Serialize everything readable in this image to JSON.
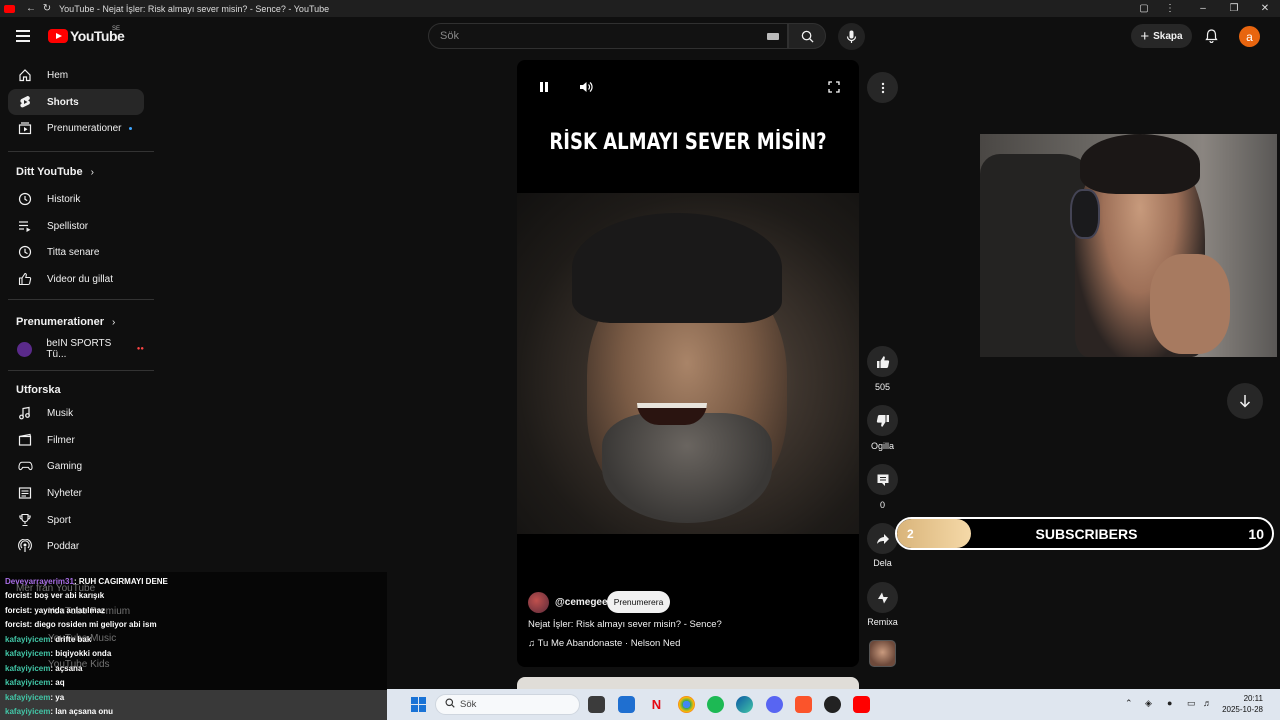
{
  "window": {
    "title": "YouTube - Nejat İşler: Risk almayı sever misin? - Sence? - YouTube"
  },
  "masthead": {
    "logo_text": "YouTube",
    "region": "SE",
    "search_placeholder": "Sök",
    "create_label": "Skapa",
    "avatar_letter": "a"
  },
  "sidebar": {
    "main": [
      {
        "label": "Hem",
        "icon": "home-icon"
      },
      {
        "label": "Shorts",
        "icon": "shorts-icon",
        "active": true
      },
      {
        "label": "Prenumerationer",
        "icon": "subscriptions-icon"
      }
    ],
    "you_title": "Ditt YouTube",
    "you": [
      {
        "label": "Historik",
        "icon": "history-icon"
      },
      {
        "label": "Spellistor",
        "icon": "playlist-icon"
      },
      {
        "label": "Titta senare",
        "icon": "watch-later-icon"
      },
      {
        "label": "Videor du gillat",
        "icon": "like-icon"
      }
    ],
    "subs_title": "Prenumerationer",
    "subs": [
      {
        "label": "beIN SPORTS Tü...",
        "icon": "channel-avatar"
      }
    ],
    "explore_title": "Utforska",
    "explore": [
      {
        "label": "Musik",
        "icon": "music-icon"
      },
      {
        "label": "Filmer",
        "icon": "film-icon"
      },
      {
        "label": "Gaming",
        "icon": "gaming-icon"
      },
      {
        "label": "Nyheter",
        "icon": "news-icon"
      },
      {
        "label": "Sport",
        "icon": "trophy-icon"
      },
      {
        "label": "Poddar",
        "icon": "podcast-icon"
      }
    ],
    "more_title": "Mer från YouTube",
    "more": [
      "YouTube Premium",
      "YouTube Music",
      "YouTube Kids"
    ]
  },
  "chat": [
    {
      "user": "Deveyarrayerim31",
      "msg": ": RUH CAGIRMAYI DENE",
      "color": "purple"
    },
    {
      "user": "forcist",
      "msg": ": boş ver abi karışık",
      "color": "white"
    },
    {
      "user": "forcist",
      "msg": ": yayında anlatılmaz",
      "color": "white"
    },
    {
      "user": "forcist",
      "msg": ": diego rosiden mi geliyor abi ism",
      "color": "white"
    },
    {
      "user": "kafayiyicem",
      "msg": ": drifte bak",
      "color": "green"
    },
    {
      "user": "kafayiyicem",
      "msg": ": biqiyokki onda",
      "color": "green"
    },
    {
      "user": "kafayiyicem",
      "msg": ": açsana",
      "color": "green"
    },
    {
      "user": "kafayiyicem",
      "msg": ": aq",
      "color": "green"
    },
    {
      "user": "kafayiyicem",
      "msg": ": ya",
      "color": "green"
    },
    {
      "user": "kafayiyicem",
      "msg": ": lan açsana onu",
      "color": "green"
    }
  ],
  "player": {
    "title_overlay": "RİSK ALMAYI SEVER MİSİN?",
    "channel": "@cemegee",
    "subscribe_label": "Prenumerera",
    "description": "Nejat İşler: Risk almayı sever misin? - Sence?",
    "music": "Tu Me Abandonaste · Nelson Ned"
  },
  "actions": {
    "likes": "505",
    "dislike_label": "Ogilla",
    "comments": "0",
    "share_label": "Dela",
    "remix_label": "Remixa"
  },
  "subgoal": {
    "current": "2",
    "label": "SUBSCRIBERS",
    "goal": "10",
    "progress": 0.2
  },
  "taskbar": {
    "search_placeholder": "Sök",
    "time": "20:11",
    "date": "2025-10-28"
  }
}
